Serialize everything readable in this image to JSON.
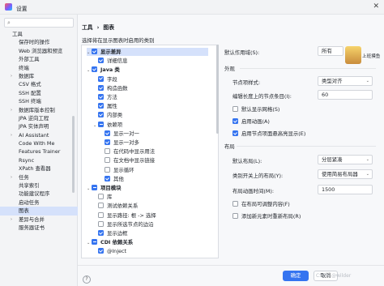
{
  "window": {
    "title": "设置",
    "close_glyph": "✕"
  },
  "sidebar": {
    "search_placeholder": "",
    "items": [
      {
        "label": "工具",
        "indent": 0,
        "chev": "",
        "selected": false
      },
      {
        "label": "保存时的操作",
        "indent": 1,
        "chev": "",
        "selected": false
      },
      {
        "label": "Web 浏览器和预览",
        "indent": 1,
        "chev": "",
        "selected": false
      },
      {
        "label": "外部工具",
        "indent": 1,
        "chev": "",
        "selected": false
      },
      {
        "label": "终端",
        "indent": 1,
        "chev": "",
        "selected": false
      },
      {
        "label": "数据库",
        "indent": 1,
        "chev": "›",
        "selected": false
      },
      {
        "label": "CSV 格式",
        "indent": 1,
        "chev": "",
        "selected": false
      },
      {
        "label": "SSH 配置",
        "indent": 1,
        "chev": "",
        "selected": false
      },
      {
        "label": "SSH 终端",
        "indent": 1,
        "chev": "",
        "selected": false
      },
      {
        "label": "数据库版本控制",
        "indent": 1,
        "chev": "›",
        "selected": false
      },
      {
        "label": "JPA 逆向工程",
        "indent": 1,
        "chev": "",
        "selected": false
      },
      {
        "label": "JPA 实体声明",
        "indent": 1,
        "chev": "",
        "selected": false
      },
      {
        "label": "AI Assistant",
        "indent": 1,
        "chev": "›",
        "selected": false
      },
      {
        "label": "Code With Me",
        "indent": 1,
        "chev": "",
        "selected": false
      },
      {
        "label": "Features Trainer",
        "indent": 1,
        "chev": "",
        "selected": false
      },
      {
        "label": "Rsync",
        "indent": 1,
        "chev": "",
        "selected": false
      },
      {
        "label": "XPath 查看器",
        "indent": 1,
        "chev": "",
        "selected": false
      },
      {
        "label": "任务",
        "indent": 1,
        "chev": "›",
        "selected": false
      },
      {
        "label": "共享索引",
        "indent": 1,
        "chev": "",
        "selected": false
      },
      {
        "label": "功能建议程序",
        "indent": 1,
        "chev": "",
        "selected": false
      },
      {
        "label": "启动任务",
        "indent": 1,
        "chev": "",
        "selected": false
      },
      {
        "label": "图表",
        "indent": 1,
        "chev": "",
        "selected": true
      },
      {
        "label": "差异与合并",
        "indent": 1,
        "chev": "›",
        "selected": false
      },
      {
        "label": "服务器证书",
        "indent": 1,
        "chev": "",
        "selected": false
      }
    ]
  },
  "breadcrumb": {
    "parent": "工具",
    "sep": "›",
    "current": "图表"
  },
  "categories": {
    "description": "选择将在显示图表时启用的类别",
    "rows": [
      {
        "label": "显示差异",
        "level": 0,
        "state": "on",
        "expander": "⌄",
        "selected": true
      },
      {
        "label": "详细信息",
        "level": 1,
        "state": "on",
        "expander": "",
        "selected": false
      },
      {
        "label": "Java 类",
        "level": 0,
        "state": "on",
        "expander": "⌄",
        "selected": false
      },
      {
        "label": "字段",
        "level": 1,
        "state": "on",
        "expander": "",
        "selected": false
      },
      {
        "label": "构造函数",
        "level": 1,
        "state": "on",
        "expander": "",
        "selected": false
      },
      {
        "label": "方法",
        "level": 1,
        "state": "on",
        "expander": "",
        "selected": false
      },
      {
        "label": "属性",
        "level": 1,
        "state": "on",
        "expander": "",
        "selected": false
      },
      {
        "label": "内部类",
        "level": 1,
        "state": "on",
        "expander": "",
        "selected": false
      },
      {
        "label": "依赖项",
        "level": 1,
        "state": "part",
        "expander": "⌄",
        "selected": false
      },
      {
        "label": "显示一对一",
        "level": 2,
        "state": "on",
        "expander": "",
        "selected": false
      },
      {
        "label": "显示一对多",
        "level": 2,
        "state": "on",
        "expander": "",
        "selected": false
      },
      {
        "label": "在代码中显示用法",
        "level": 2,
        "state": "off",
        "expander": "",
        "selected": false
      },
      {
        "label": "在文档中显示链接",
        "level": 2,
        "state": "off",
        "expander": "",
        "selected": false
      },
      {
        "label": "显示循环",
        "level": 2,
        "state": "off",
        "expander": "",
        "selected": false
      },
      {
        "label": "其他",
        "level": 2,
        "state": "on",
        "expander": "",
        "selected": false
      },
      {
        "label": "项目模块",
        "level": 0,
        "state": "part",
        "expander": "⌄",
        "selected": false
      },
      {
        "label": "库",
        "level": 1,
        "state": "off",
        "expander": "",
        "selected": false
      },
      {
        "label": "测试依赖关系",
        "level": 1,
        "state": "off",
        "expander": "",
        "selected": false
      },
      {
        "label": "显示路径: 根 -> 选择",
        "level": 1,
        "state": "off",
        "expander": "",
        "selected": false
      },
      {
        "label": "显示所选节点的边沿",
        "level": 1,
        "state": "off",
        "expander": "",
        "selected": false
      },
      {
        "label": "显示边框",
        "level": 1,
        "state": "on",
        "expander": "",
        "selected": false
      },
      {
        "label": "CDI 依赖关系",
        "level": 0,
        "state": "part",
        "expander": "⌄",
        "selected": false
      },
      {
        "label": "@Inject",
        "level": 1,
        "state": "on",
        "expander": "",
        "selected": false
      }
    ]
  },
  "settings": {
    "default_scope_label": "默认作用域(S):",
    "default_scope_value": "所有",
    "appearance_header": "外观",
    "node_layout_label": "节点项样式:",
    "node_layout_value": "类型对齐",
    "node_label_length_label": "编辑长度上的节点条目(I):",
    "node_label_length_value": "60",
    "show_grid_label": "默认显示网格(S)",
    "show_grid": false,
    "enable_anim_label": "启用动画(A)",
    "enable_anim": true,
    "highlight_label": "启用节点项面悬高亮显示(E)",
    "highlight": true,
    "layout_header": "布局",
    "default_layout_label": "默认布局(L):",
    "default_layout_value": "分层紧凑",
    "switch_layout_label": "类别开关上的布局(Y):",
    "switch_layout_value": "使用简易布局器",
    "anim_duration_label": "布局动画时间(M):",
    "anim_duration_value": "1500",
    "layout_on_change_label": "在布局可调整内容(F)",
    "layout_on_change": false,
    "relayout_new_label": "添加新元素时重新布局(R)",
    "relayout_new": false
  },
  "buttons": {
    "ok": "确定",
    "cancel": "取消",
    "help": "?"
  },
  "overlay": {
    "text": "上班摸鱼"
  },
  "watermark": "CSDN @wilder",
  "colors": {
    "accent": "#3574f0",
    "selected_bg": "#d5e1fb"
  }
}
